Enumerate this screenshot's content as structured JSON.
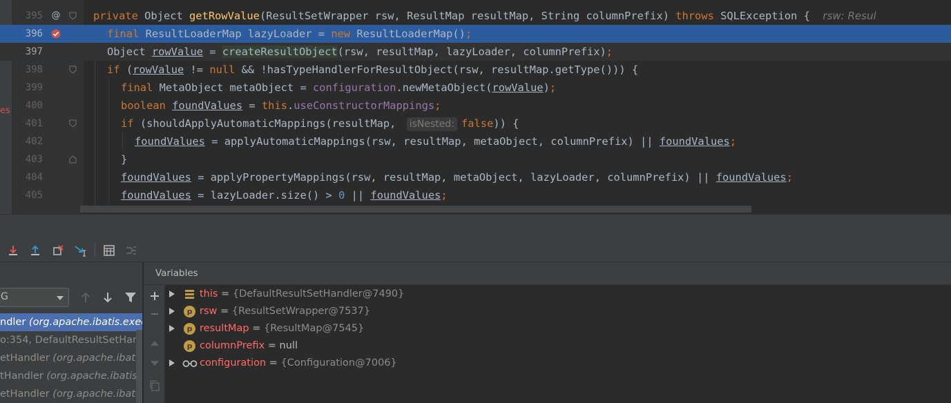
{
  "editor": {
    "left_fragment": "es",
    "lines": [
      {
        "num": "395",
        "mark": "@"
      },
      {
        "num": "396",
        "mark": "breakpoint"
      },
      {
        "num": "397",
        "mark": ""
      },
      {
        "num": "398",
        "mark": ""
      },
      {
        "num": "399",
        "mark": ""
      },
      {
        "num": "400",
        "mark": ""
      },
      {
        "num": "401",
        "mark": ""
      },
      {
        "num": "402",
        "mark": ""
      },
      {
        "num": "403",
        "mark": ""
      },
      {
        "num": "404",
        "mark": ""
      },
      {
        "num": "405",
        "mark": ""
      }
    ],
    "code": {
      "l395": {
        "kw_private": "private",
        "type": " Object ",
        "method": "getRowValue",
        "params": "(ResultSetWrapper rsw, ResultMap resultMap, String columnPrefix) ",
        "kw_throws": "throws",
        "exc": " SQLException {",
        "inline_value": "rsw: Resul"
      },
      "l396": {
        "kw_final": "final",
        "decl": " ResultLoaderMap lazyLoader = ",
        "kw_new": "new",
        "rest": " ResultLoaderMap()",
        "semi": ";"
      },
      "l397": {
        "type": "Object ",
        "var": "rowValue",
        "eq": " = ",
        "call": "createResultObject",
        "args": "(rsw, resultMap, lazyLoader, columnPrefix)",
        "semi": ";"
      },
      "l398": {
        "kw_if": "if",
        "open": " (",
        "var": "rowValue",
        "neq": " != ",
        "kw_null": "null",
        "rest": " && !hasTypeHandlerForResultObject(rsw, resultMap.getType())) {"
      },
      "l399": {
        "kw_final": "final",
        "decl": " MetaObject metaObject = ",
        "fld": "configuration",
        "call": ".newMetaObject(",
        "var": "rowValue",
        "close": ")",
        "semi": ";"
      },
      "l400": {
        "kw_boolean": "boolean",
        "sp": " ",
        "var": "foundValues",
        "eq": " = ",
        "kw_this": "this",
        "dot": ".",
        "fld": "useConstructorMappings",
        "semi": ";"
      },
      "l401": {
        "kw_if": "if",
        "rest": " (shouldApplyAutomaticMappings(resultMap, ",
        "hint": "isNested:",
        "kw_false": "false",
        "close": ")) {"
      },
      "l402": {
        "var": "foundValues",
        "rest": " = applyAutomaticMappings(rsw, resultMap, metaObject, columnPrefix) || ",
        "var2": "foundValues",
        "semi": ";"
      },
      "l403": {
        "brace": "}"
      },
      "l404": {
        "var": "foundValues",
        "rest": " = applyPropertyMappings(rsw, resultMap, metaObject, lazyLoader, columnPrefix) || ",
        "var2": "foundValues",
        "semi": ";"
      },
      "l405": {
        "var": "foundValues",
        "rest": " = lazyLoader.size() > ",
        "num": "0",
        "or": " || ",
        "var2": "foundValues",
        "semi": ";"
      }
    }
  },
  "frames": {
    "thread_value": "G",
    "rows": [
      {
        "method": "ndler",
        "pkg": " (org.apache.ibatis.exec"
      },
      {
        "method": "o:354, DefaultResultSetHandl",
        "pkg": ""
      },
      {
        "method": "etHandler",
        "pkg": " (org.apache.ibatis."
      },
      {
        "method": "tHandler",
        "pkg": " (org.apache.ibatis.e"
      },
      {
        "method": "etHandler",
        "pkg": " (org.apache.ibatis."
      }
    ]
  },
  "variables": {
    "title": "Variables",
    "items": [
      {
        "name": "this",
        "eq": " = ",
        "value": "{DefaultResultSetHandler@7490}",
        "icon": "field-list-icon",
        "expandable": true
      },
      {
        "name": "rsw",
        "eq": " = ",
        "value": "{ResultSetWrapper@7537}",
        "icon": "parameter-icon",
        "badge": "p",
        "expandable": true
      },
      {
        "name": "resultMap",
        "eq": " = ",
        "value": "{ResultMap@7545}",
        "icon": "parameter-icon",
        "badge": "p",
        "expandable": true
      },
      {
        "name": "columnPrefix",
        "eq": " = ",
        "value": "null",
        "icon": "parameter-icon",
        "badge": "p",
        "expandable": false
      },
      {
        "name": "configuration",
        "eq": " = ",
        "value": "{Configuration@7006}",
        "icon": "watch-glasses-icon",
        "expandable": true
      }
    ]
  },
  "colors": {
    "editor_bg": "#2b2b2b",
    "selection": "#2d5c9e",
    "keyword": "#cc7832",
    "method_decl": "#ffc66d",
    "field": "#9876aa",
    "number": "#6897bb",
    "var_name": "#ff6b68",
    "selected_frame": "#4b6eaf"
  }
}
